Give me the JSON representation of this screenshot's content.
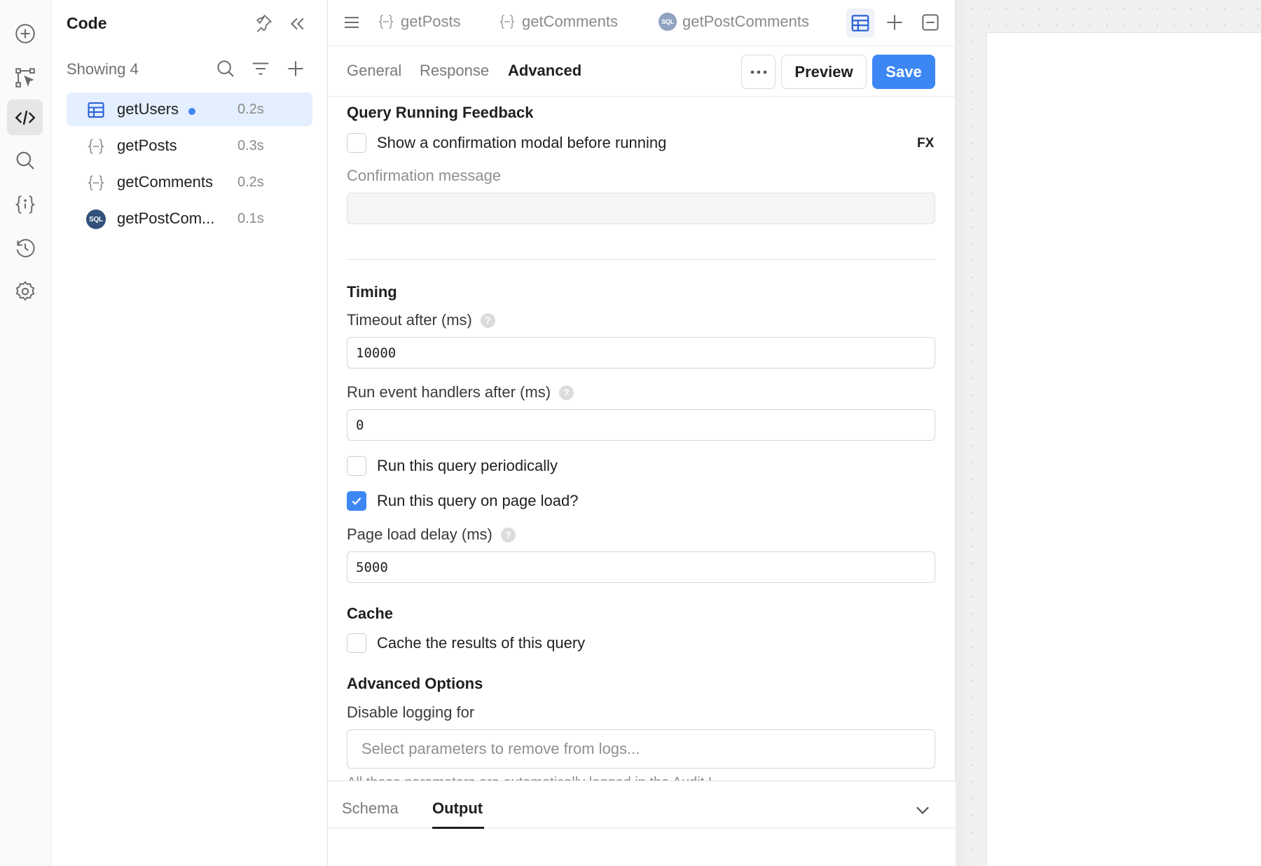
{
  "sidebar": {
    "title": "Code",
    "showing": "Showing 4",
    "queries": [
      {
        "name": "getUsers",
        "time": "0.2s",
        "type": "table",
        "selected": true,
        "unsaved": true
      },
      {
        "name": "getPosts",
        "time": "0.3s",
        "type": "js"
      },
      {
        "name": "getComments",
        "time": "0.2s",
        "type": "js"
      },
      {
        "name": "getPostCom...",
        "time": "0.1s",
        "type": "sql"
      }
    ]
  },
  "tabs": {
    "items": [
      {
        "label": "getPosts"
      },
      {
        "label": "getComments"
      },
      {
        "label": "getPostComments"
      }
    ]
  },
  "badges": {
    "sql": "SQL"
  },
  "editor": {
    "subtabs": [
      "General",
      "Response",
      "Advanced"
    ],
    "active_subtab": "Advanced",
    "preview_label": "Preview",
    "save_label": "Save"
  },
  "feedback": {
    "title": "Query Running Feedback",
    "confirm_modal_label": "Show a confirmation modal before running",
    "confirm_modal_checked": false,
    "fx_label": "FX",
    "confirmation_message_label": "Confirmation message",
    "confirmation_message_value": ""
  },
  "timing": {
    "title": "Timing",
    "timeout_label": "Timeout after (ms)",
    "timeout_value": "10000",
    "event_handlers_label": "Run event handlers after (ms)",
    "event_handlers_value": "0",
    "periodic_label": "Run this query periodically",
    "periodic_checked": false,
    "page_load_label": "Run this query on page load?",
    "page_load_checked": true,
    "page_load_delay_label": "Page load delay (ms)",
    "page_load_delay_value": "5000",
    "help_glyph": "?"
  },
  "cache": {
    "title": "Cache",
    "cache_label": "Cache the results of this query",
    "cache_checked": false
  },
  "advanced": {
    "title": "Advanced Options",
    "disable_logging_label": "Disable logging for",
    "disable_logging_placeholder": "Select parameters to remove from logs...",
    "clipped_note": "All these parameters are automatically logged in the Audit L"
  },
  "bottom": {
    "tabs": [
      "Schema",
      "Output"
    ],
    "active_tab": "Output"
  },
  "colors": {
    "accent": "#3d87f5",
    "selected_bg": "#e4efff",
    "sql_badge": "#31507a"
  },
  "icons": {
    "rail": [
      "plus-circle-icon",
      "flow-select-icon",
      "code-icon",
      "search-icon",
      "variables-icon",
      "history-icon",
      "settings-icon"
    ],
    "sidebar_header": [
      "pin-icon",
      "collapse-icon",
      "search-icon",
      "filter-icon",
      "plus-icon"
    ],
    "tabbar": [
      "menu-icon",
      "table-icon",
      "plus-icon",
      "minimize-icon"
    ]
  }
}
